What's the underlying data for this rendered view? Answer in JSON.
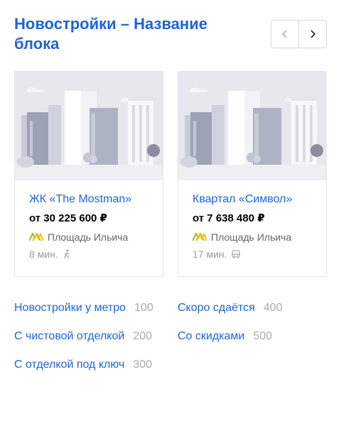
{
  "header": {
    "title": "Новостройки – Название блока",
    "prev_icon": "chevron-left-icon",
    "next_icon": "chevron-right-icon"
  },
  "cards": [
    {
      "name": "ЖК «The Mostman»",
      "price": "от 30 225 600 ₽",
      "metro_station": "Площадь Ильича",
      "metro_icon": "metro-logo-icon",
      "distance": "8 мин.",
      "transport_icon": "walk-icon"
    },
    {
      "name": "Квартал «Символ»",
      "price": "от 7 638 480 ₽",
      "metro_station": "Площадь Ильича",
      "metro_icon": "metro-logo-icon",
      "distance": "17 мин.",
      "transport_icon": "bus-icon"
    }
  ],
  "links": [
    {
      "label": "Новостройки у метро",
      "count": "100"
    },
    {
      "label": "С чистовой отделкой",
      "count": "200"
    },
    {
      "label": "С отделкой под ключ",
      "count": "300"
    },
    {
      "label": "Скоро сдаётся",
      "count": "400"
    },
    {
      "label": "Со скидками",
      "count": "500"
    }
  ],
  "colors": {
    "link": "#1f63d6",
    "metro_line_green": "#8cc63f",
    "metro_line_yellow": "#ffc20e",
    "placeholder_sky": "#e6e8ee",
    "placeholder_building": "#b8bccb"
  }
}
